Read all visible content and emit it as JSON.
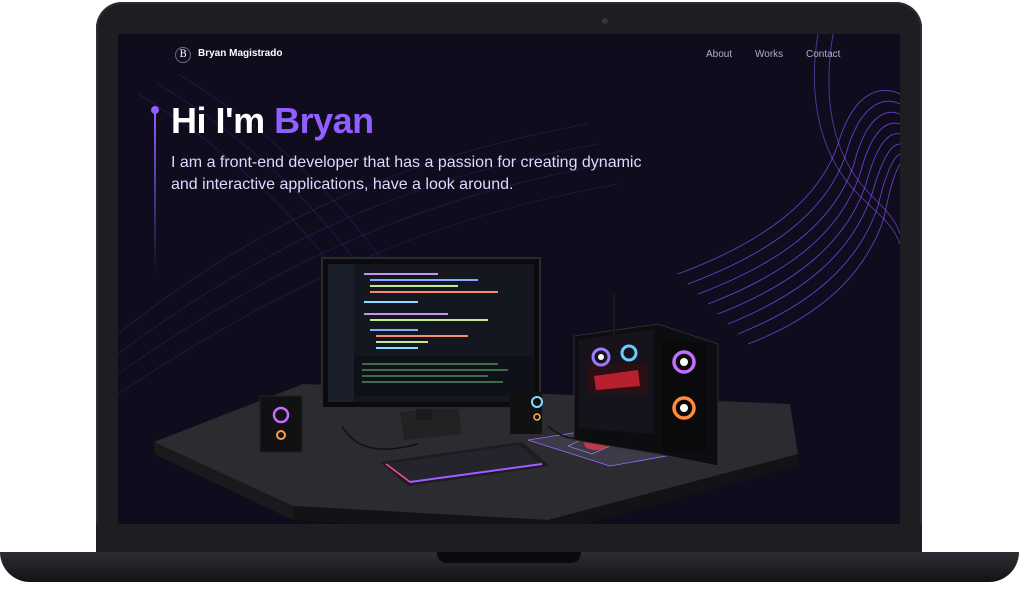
{
  "nav": {
    "logo_letter": "B",
    "brand": "Bryan Magistrado",
    "links": [
      "About",
      "Works",
      "Contact"
    ]
  },
  "hero": {
    "greeting": "Hi I'm ",
    "name": "Bryan",
    "subtitle": "I am a front-end developer that has a passion for creating dynamic and interactive applications, have a look around."
  },
  "colors": {
    "accent": "#915eff",
    "background": "#0e0c1d",
    "text": "#ffffff",
    "subtitle": "#dfd9ff"
  }
}
